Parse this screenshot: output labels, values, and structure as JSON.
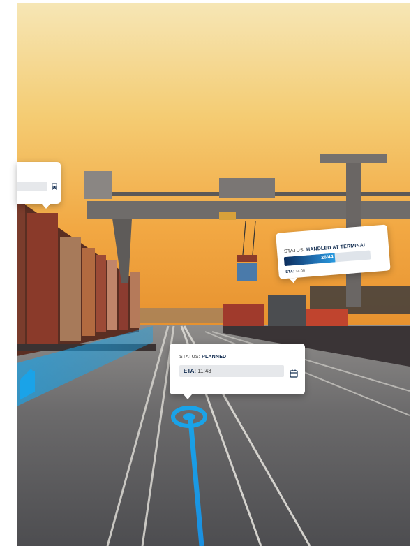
{
  "scene": {
    "sky_top": "#f6e5b0",
    "sky_bottom": "#f1a53c",
    "accent": "#1aa3e8",
    "navy": "#0f2a4e"
  },
  "left_callout": {
    "icon": "train-icon"
  },
  "terminal_callout": {
    "status_label": "STATUS:",
    "status_value": "HANDLED AT TERMINAL",
    "progress_text": "26/44",
    "progress_done": 26,
    "progress_total": 44,
    "eta_label": "ETA:",
    "eta_value": "14:00"
  },
  "planned_callout": {
    "status_label": "STATUS:",
    "status_value": "PLANNED",
    "eta_label": "ETA:",
    "eta_value": "11:43",
    "icon": "calendar-icon"
  },
  "navigation": {
    "back_icon": "chevron-left-icon",
    "location_icon": "location-ring-icon"
  }
}
